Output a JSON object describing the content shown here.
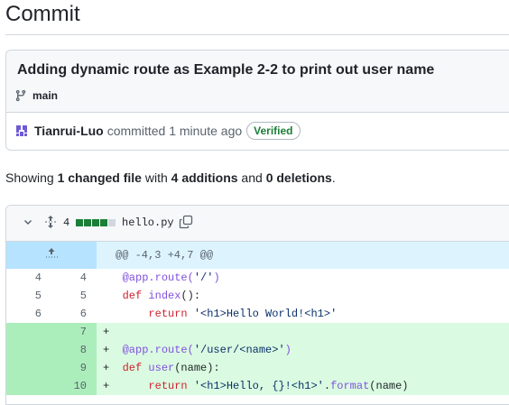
{
  "page": {
    "title": "Commit"
  },
  "commit": {
    "message": "Adding dynamic route as Example 2-2 to print out user name",
    "branch": "main",
    "author": "Tianrui-Luo",
    "action_text": "committed 1 minute ago",
    "verified_label": "Verified"
  },
  "summary": {
    "prefix": "Showing ",
    "changed": "1 changed file",
    "mid1": " with ",
    "additions": "4 additions",
    "mid2": " and ",
    "deletions": "0 deletions",
    "suffix": "."
  },
  "file": {
    "change_count": "4",
    "name": "hello.py",
    "stat_colors": [
      "#1a7f37",
      "#1a7f37",
      "#1a7f37",
      "#1a7f37",
      "#d0d7de"
    ]
  },
  "diff": {
    "hunk_header": "@@ -4,3 +4,7 @@",
    "lines": [
      {
        "old": "4",
        "new": "4",
        "sign": " ",
        "code": [
          {
            "t": "@app.route(",
            "c": "dec"
          },
          {
            "t": "'/'",
            "c": "str"
          },
          {
            "t": ")",
            "c": "dec"
          }
        ]
      },
      {
        "old": "5",
        "new": "5",
        "sign": " ",
        "code": [
          {
            "t": "def",
            "c": "kw"
          },
          {
            "t": " "
          },
          {
            "t": "index",
            "c": "fn"
          },
          {
            "t": "():"
          }
        ]
      },
      {
        "old": "6",
        "new": "6",
        "sign": " ",
        "code": [
          {
            "t": "    "
          },
          {
            "t": "return",
            "c": "kw"
          },
          {
            "t": " "
          },
          {
            "t": "'<h1>Hello World!<h1>'",
            "c": "str"
          }
        ]
      },
      {
        "old": "",
        "new": "7",
        "sign": "+",
        "code": []
      },
      {
        "old": "",
        "new": "8",
        "sign": "+",
        "code": [
          {
            "t": "@app.route(",
            "c": "dec"
          },
          {
            "t": "'/user/<name>'",
            "c": "str"
          },
          {
            "t": ")",
            "c": "dec"
          }
        ]
      },
      {
        "old": "",
        "new": "9",
        "sign": "+",
        "code": [
          {
            "t": "def",
            "c": "kw"
          },
          {
            "t": " "
          },
          {
            "t": "user",
            "c": "fn"
          },
          {
            "t": "(name):"
          }
        ]
      },
      {
        "old": "",
        "new": "10",
        "sign": "+",
        "code": [
          {
            "t": "    "
          },
          {
            "t": "return",
            "c": "kw"
          },
          {
            "t": " "
          },
          {
            "t": "'<h1>Hello, {}!<h1>'",
            "c": "str"
          },
          {
            "t": "."
          },
          {
            "t": "format",
            "c": "fn"
          },
          {
            "t": "(name)"
          }
        ]
      }
    ]
  }
}
